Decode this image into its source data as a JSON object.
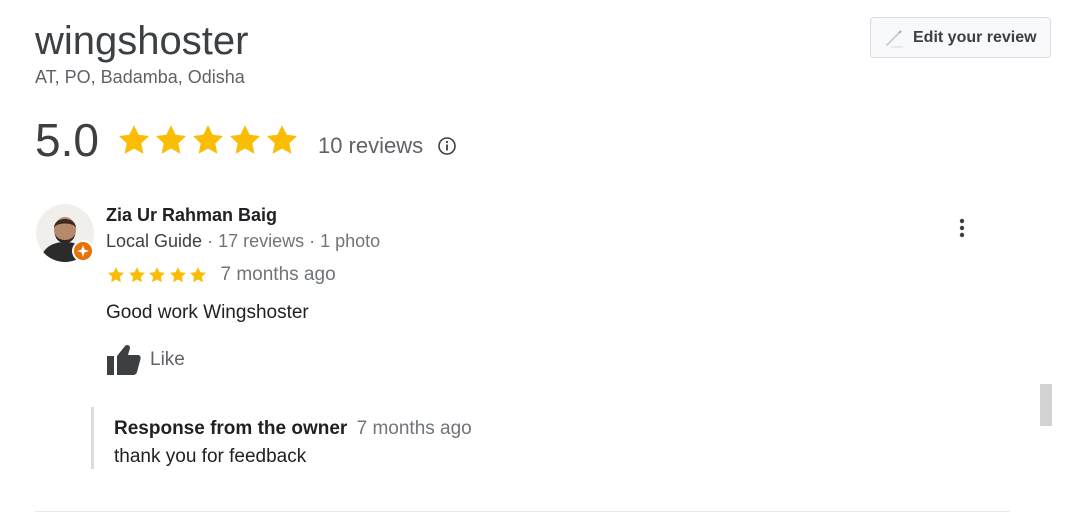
{
  "business": {
    "name": "wingshoster",
    "address": "AT, PO, Badamba, Odisha",
    "rating": "5.0",
    "stars": 5,
    "review_count": "10 reviews",
    "edit_review_label": "Edit your review"
  },
  "review": {
    "author": "Zia Ur Rahman Baig",
    "badge": "Local Guide",
    "meta": " · 17 reviews · 1 photo",
    "stars": 5,
    "time": "7 months ago",
    "text": "Good work Wingshoster",
    "like_label": "Like",
    "owner_response": {
      "title": "Response from the owner",
      "time": "7 months ago",
      "text": "thank you for feedback"
    }
  },
  "colors": {
    "star": "#fbbc04",
    "local_guide_badge": "#e8710a",
    "text_secondary": "#70757a"
  },
  "icons": [
    "pencil-icon",
    "star-icon",
    "info-icon",
    "local-guide-badge-icon",
    "more-vert-icon",
    "thumbs-up-icon"
  ]
}
